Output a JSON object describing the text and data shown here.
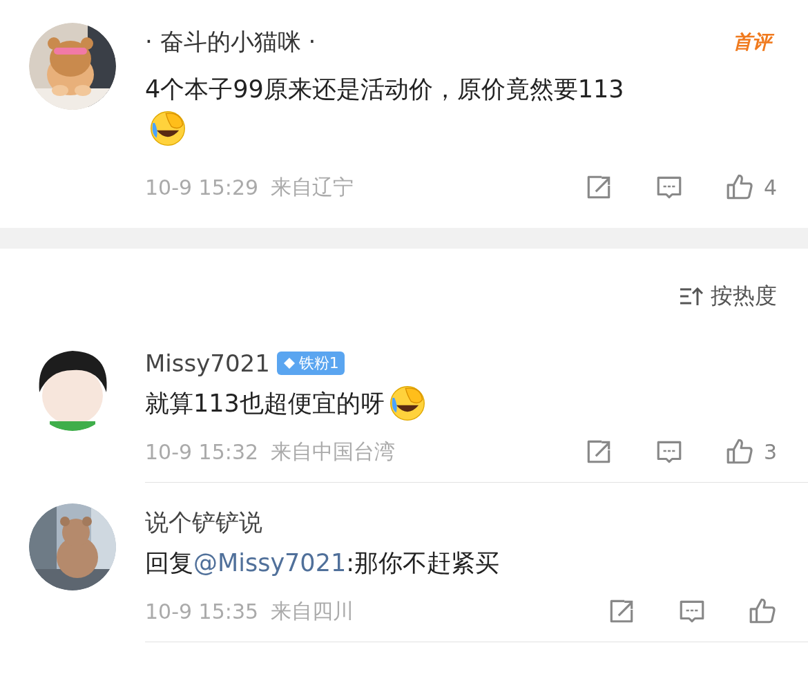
{
  "top_comment": {
    "author": "· 奋斗的小猫咪 ·",
    "tag": "首评",
    "text": "4个本子99原来还是活动价，原价竟然要113",
    "emoji": true,
    "time": "10-9 15:29",
    "location": "来自辽宁",
    "likes": "4"
  },
  "sort": {
    "label": "按热度"
  },
  "replies": [
    {
      "author": "Missy7021",
      "fan_badge": "铁粉1",
      "text": "就算113也超便宜的呀",
      "emoji": true,
      "time": "10-9 15:32",
      "location": "来自中国台湾",
      "likes": "3"
    },
    {
      "author": "说个铲铲说",
      "reply_prefix": "回复",
      "reply_to": "@Missy7021",
      "text": ":那你不赶紧买",
      "time": "10-9 15:35",
      "location": "来自四川"
    }
  ]
}
